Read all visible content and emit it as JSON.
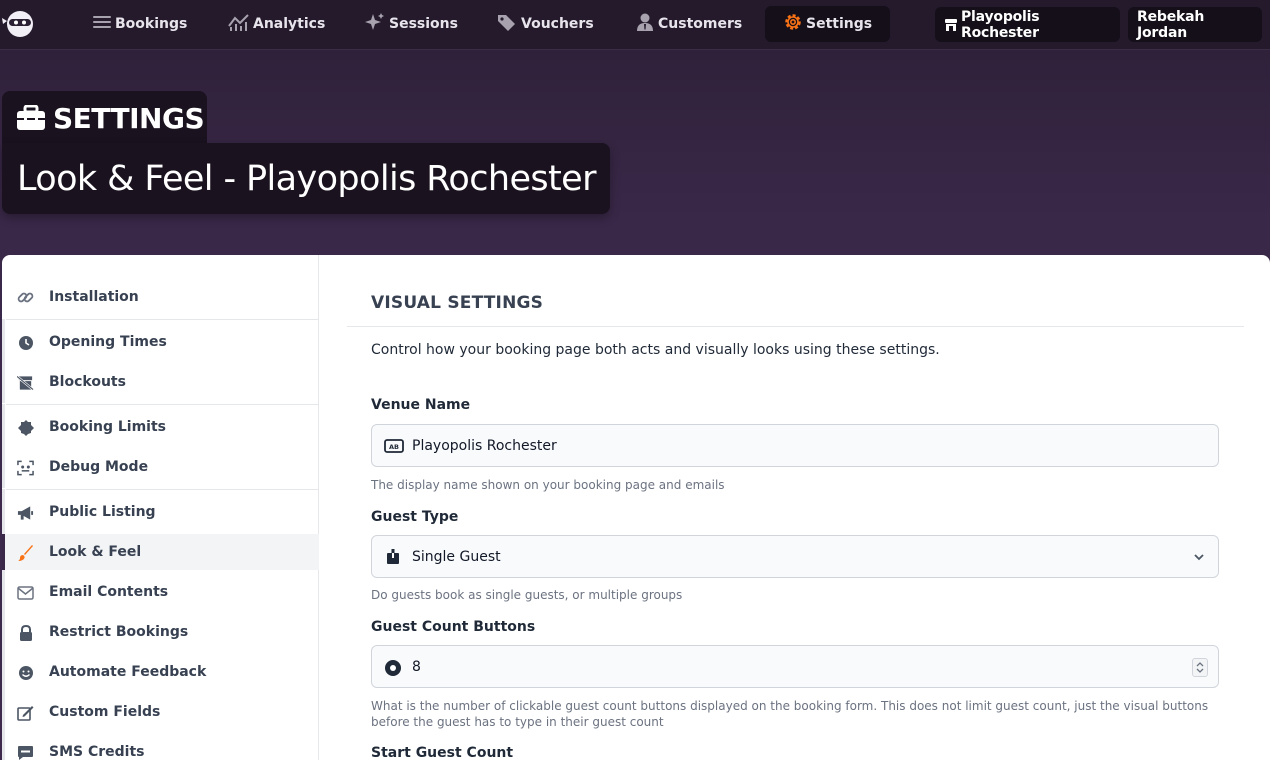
{
  "nav": {
    "items": [
      {
        "label": "Bookings",
        "icon": "bars-icon"
      },
      {
        "label": "Analytics",
        "icon": "chart-icon"
      },
      {
        "label": "Sessions",
        "icon": "sparkle-icon"
      },
      {
        "label": "Vouchers",
        "icon": "tags-icon"
      },
      {
        "label": "Customers",
        "icon": "user-tie-icon"
      },
      {
        "label": "Settings",
        "icon": "gear-icon",
        "active": true
      }
    ],
    "venue": "Playopolis Rochester",
    "user": "Rebekah Jordan",
    "accent": "#f97316"
  },
  "header": {
    "tag": "SETTINGS",
    "title": "Look & Feel - Playopolis Rochester"
  },
  "sidebar": {
    "items": [
      {
        "label": "Installation",
        "icon": "link-icon"
      },
      {
        "label": "Opening Times",
        "icon": "clock-icon"
      },
      {
        "label": "Blockouts",
        "icon": "store-slash-icon"
      },
      {
        "label": "Booking Limits",
        "icon": "certificate-icon"
      },
      {
        "label": "Debug Mode",
        "icon": "scan-icon"
      },
      {
        "label": "Public Listing",
        "icon": "megaphone-icon"
      },
      {
        "label": "Look & Feel",
        "icon": "paintbrush-icon",
        "active": true
      },
      {
        "label": "Email Contents",
        "icon": "envelope-icon"
      },
      {
        "label": "Restrict Bookings",
        "icon": "lock-icon"
      },
      {
        "label": "Automate Feedback",
        "icon": "smile-icon"
      },
      {
        "label": "Custom Fields",
        "icon": "edit-icon"
      },
      {
        "label": "SMS Credits",
        "icon": "sms-icon"
      }
    ]
  },
  "main": {
    "section_title": "VISUAL SETTINGS",
    "intro": "Control how your booking page both acts and visually looks using these settings.",
    "venue_name": {
      "label": "Venue Name",
      "value": "Playopolis Rochester",
      "help": "The display name shown on your booking page and emails"
    },
    "guest_type": {
      "label": "Guest Type",
      "value": "Single Guest",
      "help": "Do guests book as single guests, or multiple groups"
    },
    "guest_count_buttons": {
      "label": "Guest Count Buttons",
      "value": "8",
      "help": "What is the number of clickable guest count buttons displayed on the booking form. This does not limit guest count, just the visual buttons before the guest has to type in their guest count"
    },
    "start_guest_count": {
      "label": "Start Guest Count"
    }
  }
}
